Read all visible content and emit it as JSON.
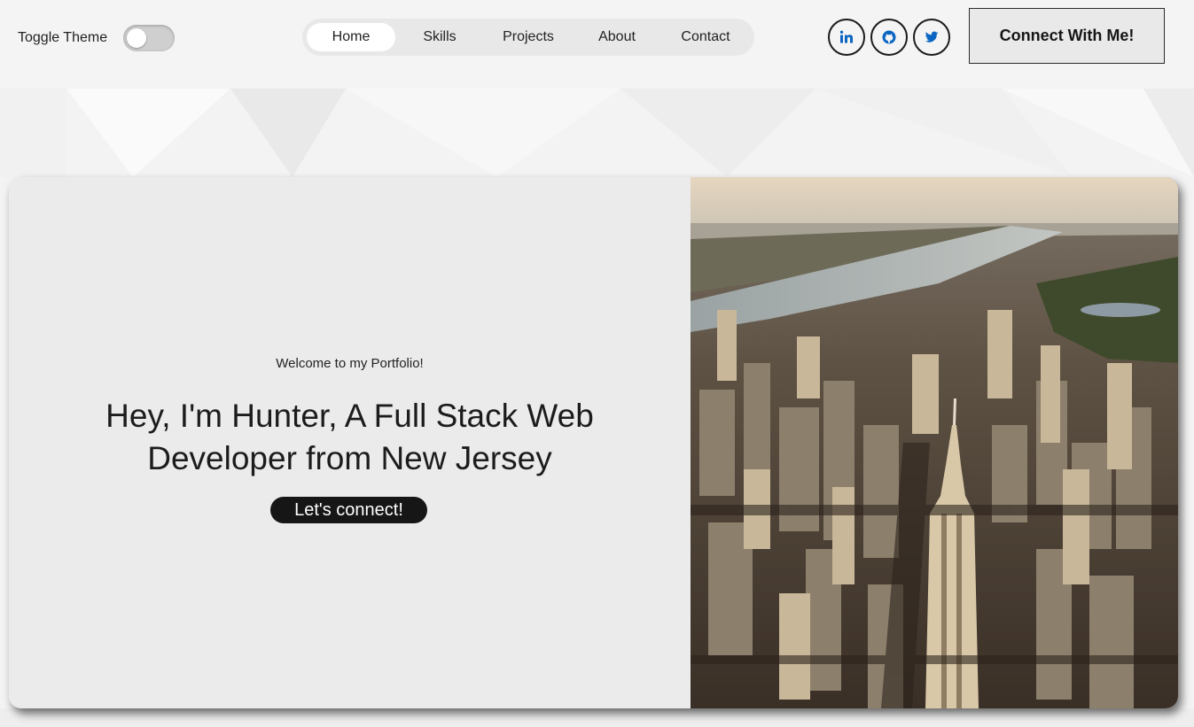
{
  "theme": {
    "label": "Toggle Theme",
    "enabled": false
  },
  "nav": {
    "items": [
      {
        "label": "Home",
        "active": true
      },
      {
        "label": "Skills",
        "active": false
      },
      {
        "label": "Projects",
        "active": false
      },
      {
        "label": "About",
        "active": false
      },
      {
        "label": "Contact",
        "active": false
      }
    ]
  },
  "social": [
    {
      "icon": "linkedin-icon",
      "color": "#0a66c2"
    },
    {
      "icon": "github-icon",
      "color": "#0a66c2"
    },
    {
      "icon": "twitter-icon",
      "color": "#0a66c2"
    }
  ],
  "header": {
    "connect_label": "Connect With Me!"
  },
  "hero": {
    "welcome": "Welcome to my Portfolio!",
    "headline_line1": "Hey, I'm Hunter, A Full Stack Web",
    "headline_line2": "Developer from New Jersey",
    "cta_label": "Let's connect!",
    "image": "aerial-nyc-skyline-image"
  },
  "colors": {
    "page_bg": "#f3f3f3",
    "card_bg": "#ebebeb",
    "cta_bg": "#161616",
    "icon_accent": "#0a66c2"
  }
}
